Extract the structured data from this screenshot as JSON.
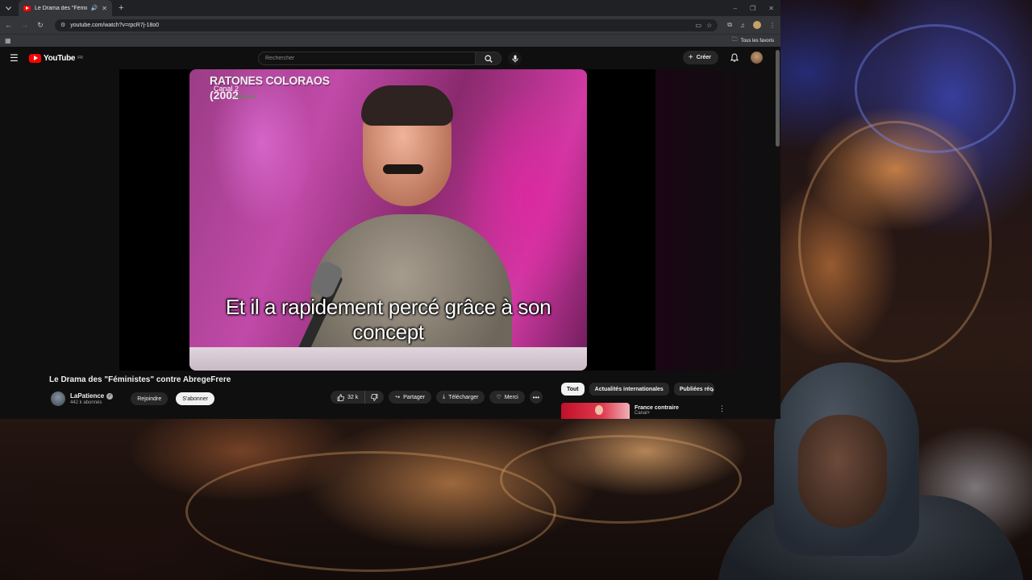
{
  "browser": {
    "tab_title": "Le Drama des \"Féministes\"",
    "url": "youtube.com/watch?v=rpcR7j-18o0",
    "bookmarks_label": "Tous les favoris"
  },
  "youtube": {
    "logo_text": "YouTube",
    "region_code": "FR",
    "search_placeholder": "Rechercher",
    "create_label": "Créer"
  },
  "video": {
    "overlay_title": "RATONES COLORAOS",
    "overlay_year": "(2002",
    "overlay_channel": "Canal 2",
    "overlay_sub": "Andalucía",
    "subtitle": "Et il a rapidement percé grâce à son concept",
    "title": "Le Drama des \"Féministes\" contre AbregeFrere"
  },
  "channel": {
    "name": "LaPatience",
    "subscribers": "442 k abonnés",
    "join_label": "Rejoindre",
    "subscribe_label": "S'abonner"
  },
  "actions": {
    "likes": "32 k",
    "share_label": "Partager",
    "download_label": "Télécharger",
    "thanks_label": "Merci"
  },
  "chips": [
    "Tout",
    "Actualités internationales",
    "Publiées réc"
  ],
  "recommendation": {
    "title": "France contraire",
    "meta": "Canal+"
  }
}
